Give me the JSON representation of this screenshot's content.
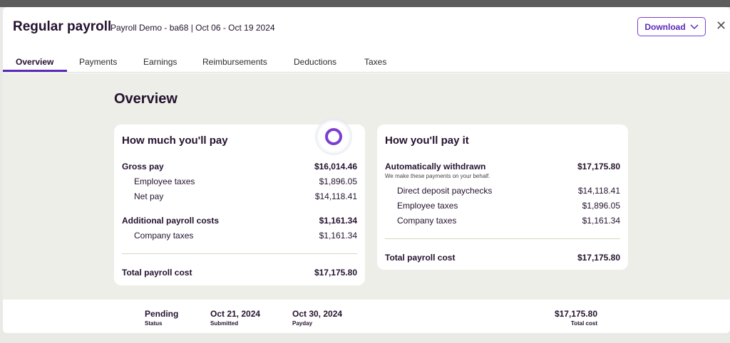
{
  "header": {
    "title": "Regular payroll",
    "subtitle": "Payroll Demo - ba68 | Oct 06 - Oct 19 2024",
    "download_label": "Download",
    "close_glyph": "✕"
  },
  "tabs": [
    {
      "label": "Overview",
      "active": true
    },
    {
      "label": "Payments"
    },
    {
      "label": "Earnings"
    },
    {
      "label": "Reimbursements"
    },
    {
      "label": "Deductions"
    },
    {
      "label": "Taxes"
    }
  ],
  "overview": {
    "title": "Overview",
    "pay_card": {
      "title": "How much you'll pay",
      "gross_pay": {
        "label": "Gross pay",
        "value": "$16,014.46"
      },
      "employee_taxes": {
        "label": "Employee taxes",
        "value": "$1,896.05"
      },
      "net_pay": {
        "label": "Net pay",
        "value": "$14,118.41"
      },
      "additional_costs": {
        "label": "Additional payroll costs",
        "value": "$1,161.34"
      },
      "company_taxes": {
        "label": "Company taxes",
        "value": "$1,161.34"
      },
      "total": {
        "label": "Total payroll cost",
        "value": "$17,175.80"
      }
    },
    "payit_card": {
      "title": "How you'll pay it",
      "auto_withdrawn": {
        "label": "Automatically withdrawn",
        "value": "$17,175.80"
      },
      "note": "We make these payments on your behalf.",
      "direct_deposit": {
        "label": "Direct deposit paychecks",
        "value": "$14,118.41"
      },
      "employee_taxes": {
        "label": "Employee taxes",
        "value": "$1,896.05"
      },
      "company_taxes": {
        "label": "Company taxes",
        "value": "$1,161.34"
      },
      "total": {
        "label": "Total payroll cost",
        "value": "$17,175.80"
      }
    }
  },
  "footer": {
    "status": {
      "value": "Pending",
      "label": "Status"
    },
    "submitted": {
      "value": "Oct 21, 2024",
      "label": "Submitted"
    },
    "payday": {
      "value": "Oct 30, 2024",
      "label": "Payday"
    },
    "total_cost": {
      "value": "$17,175.80",
      "label": "Total cost"
    }
  },
  "colors": {
    "accent": "#5b2ab8",
    "content_bg": "#eeeee8"
  }
}
